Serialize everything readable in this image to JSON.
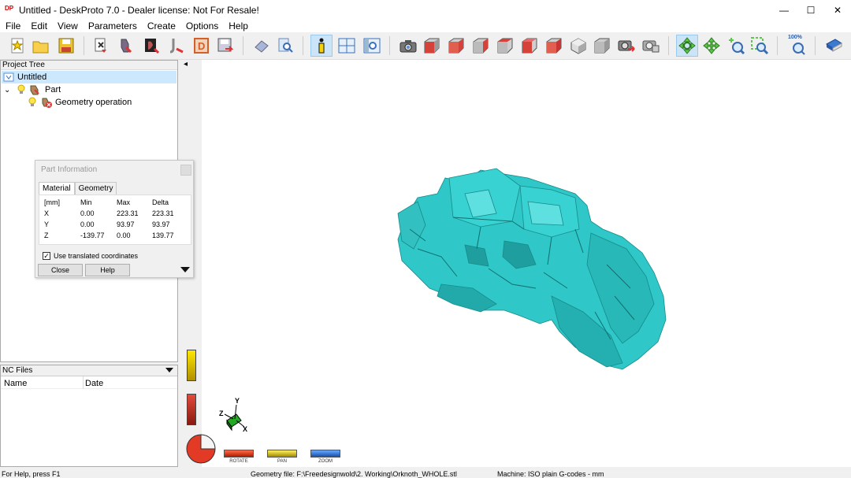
{
  "window": {
    "app_icon_text": "DP",
    "title": "Untitled - DeskProto 7.0 - Dealer license: Not For Resale!",
    "controls": {
      "minimize": "—",
      "maximize": "☐",
      "close": "✕"
    }
  },
  "menu": [
    "File",
    "Edit",
    "View",
    "Parameters",
    "Create",
    "Options",
    "Help"
  ],
  "toolbar": {
    "groups": [
      [
        "new-icon",
        "open-icon",
        "save-icon"
      ],
      [
        "import-geometry-icon",
        "part-parameters-icon",
        "vector-icon",
        "bitmap-icon",
        "drawing-icon",
        "export-icon"
      ],
      [
        "eraser-icon",
        "find-icon"
      ],
      [
        "info-icon",
        "layout-icon",
        "view-icon"
      ],
      [
        "snapshot-icon",
        "view-front-icon",
        "view-back-icon",
        "view-left-icon",
        "view-right-icon",
        "view-top-icon",
        "view-bottom-icon",
        "view-iso-icon",
        "view-default-icon",
        "render-icon",
        "render-settings-icon"
      ],
      [
        "rotate-icon",
        "pan-icon",
        "zoom-icon",
        "zoom-window-icon"
      ],
      [
        "zoom-100-icon"
      ],
      [
        "book-icon"
      ]
    ],
    "zoom_100_label": "100%"
  },
  "project_tree": {
    "header": "Project Tree",
    "items": [
      {
        "label": "Untitled",
        "level": 0
      },
      {
        "label": "Part",
        "level": 1
      },
      {
        "label": "Geometry operation",
        "level": 2
      }
    ],
    "toggle_symbol": "◂",
    "expand_symbol": "⌄"
  },
  "nc_files": {
    "header": "NC Files",
    "columns": [
      "Name",
      "Date"
    ]
  },
  "part_info": {
    "title": "Part Information",
    "tabs": [
      "Material",
      "Geometry"
    ],
    "active_tab": "Material",
    "headers": [
      "[mm]",
      "Min",
      "Max",
      "Delta"
    ],
    "rows": [
      [
        "X",
        "0.00",
        "223.31",
        "223.31"
      ],
      [
        "Y",
        "0.00",
        "93.97",
        "93.97"
      ],
      [
        "Z",
        "-139.77",
        "0.00",
        "139.77"
      ]
    ],
    "checkbox_label": "Use translated coordinates",
    "checkbox_checked": true,
    "checkbox_mark": "✓",
    "close_label": "Close",
    "help_label": "Help"
  },
  "viewport": {
    "model_color": "#2fc7c7",
    "axes": {
      "x": "X",
      "y": "Y",
      "z": "Z"
    },
    "mouse_modes": [
      "ROTATE",
      "PAN",
      "ZOOM"
    ]
  },
  "status": {
    "help": "For Help, press F1",
    "geometry": "Geometry file: F:\\Freedesignwold\\2. Working\\Orknoth_WHOLE.stl",
    "machine": "Machine: ISO plain G-codes - mm"
  }
}
